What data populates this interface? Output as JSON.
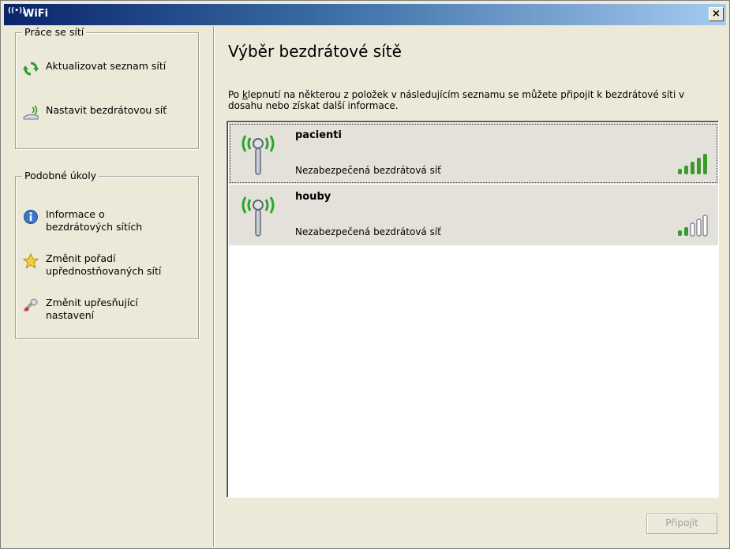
{
  "window": {
    "title": "WiFi",
    "title_icon": "((•))",
    "close_label": "×"
  },
  "sidebar": {
    "network_tasks": {
      "title": "Práce se sítí",
      "items": [
        {
          "label": "Aktualizovat seznam sítí",
          "icon": "refresh-icon"
        },
        {
          "label": "Nastavit bezdrátovou síť",
          "icon": "wireless-setup-icon"
        }
      ]
    },
    "related_tasks": {
      "title": "Podobné úkoly",
      "items": [
        {
          "label": "Informace o bezdrátových sítích",
          "line1": "Informace o",
          "line2": "bezdrátových sítích",
          "icon": "info-icon"
        },
        {
          "label": "Změnit pořadí upřednostňovaných sítí",
          "line1": "Změnit pořadí",
          "line2": "upřednostňovaných sítí",
          "icon": "star-icon"
        },
        {
          "label": "Změnit upřesňující nastavení",
          "line1": "Změnit upřesňující",
          "line2": "nastavení",
          "icon": "settings-icon"
        }
      ]
    }
  },
  "main": {
    "heading": "Výběr bezdrátové sítě",
    "description_prefix": "Po ",
    "description_underlined": "k",
    "description_rest": "lepnutí na některou z položek v následujícím seznamu se můžete připojit k bezdrátové síti v dosahu nebo získat další informace.",
    "networks": [
      {
        "name": "pacienti",
        "status": "Nezabezpečená bezdrátová síť",
        "signal_bars": 5,
        "selected": true
      },
      {
        "name": "houby",
        "status": "Nezabezpečená bezdrátová síť",
        "signal_bars": 2,
        "selected": false
      }
    ],
    "connect_button": "Připojit"
  },
  "colors": {
    "signal_green": "#3a9a2a",
    "antenna_green": "#2ca52c",
    "disabled_text": "#a0a0a0"
  }
}
